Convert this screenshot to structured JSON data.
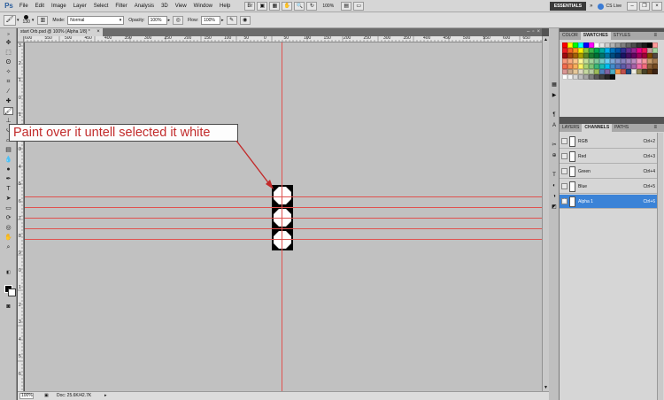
{
  "menubar": {
    "logo": "Ps",
    "items": [
      "File",
      "Edit",
      "Image",
      "Layer",
      "Select",
      "Filter",
      "Analysis",
      "3D",
      "View",
      "Window",
      "Help"
    ],
    "zoom": "100%",
    "workspace": "ESSENTIALS",
    "cs_live": "CS Live"
  },
  "options": {
    "brush_size": "130",
    "mode_label": "Mode:",
    "mode_value": "Normal",
    "opacity_label": "Opacity:",
    "opacity_value": "100%",
    "flow_label": "Flow:",
    "flow_value": "100%"
  },
  "document": {
    "tab_title": "start Orb.psd @ 100% (Alpha 1/8) *"
  },
  "ruler": {
    "h_labels": [
      "600",
      "550",
      "500",
      "450",
      "400",
      "350",
      "300",
      "250",
      "200",
      "150",
      "100",
      "50",
      "0",
      "50",
      "100",
      "150",
      "200",
      "250",
      "300",
      "350",
      "400",
      "450",
      "500",
      "550",
      "600",
      "650"
    ],
    "v_labels": [
      "3",
      "2",
      "1",
      "0",
      "1",
      "2",
      "3",
      "4",
      "5",
      "6",
      "7",
      "8",
      "9",
      "0",
      "1",
      "2",
      "3",
      "4",
      "5",
      "6"
    ]
  },
  "statusbar": {
    "zoom": "100%",
    "doc_info": "Doc: 25.6K/42.7K"
  },
  "annotation": {
    "text": "Paint over it untell selected it white"
  },
  "swatch_panel": {
    "tabs": [
      "COLOR",
      "SWATCHES",
      "STYLES"
    ],
    "active_tab": 1,
    "colors": [
      "#ff0000",
      "#ffff00",
      "#00ff00",
      "#00ffff",
      "#0000ff",
      "#ff00ff",
      "#ffffff",
      "#e6e6e6",
      "#cccccc",
      "#b3b3b3",
      "#999999",
      "#808080",
      "#666666",
      "#4d4d4d",
      "#333333",
      "#1a1a1a",
      "#000000",
      "#ff9999",
      "#ed1c24",
      "#f26522",
      "#f7941d",
      "#fff200",
      "#8dc63f",
      "#39b54a",
      "#00a651",
      "#00a99d",
      "#00aeef",
      "#0072bc",
      "#0054a6",
      "#2e3192",
      "#662d91",
      "#92278f",
      "#ec008c",
      "#ed145b",
      "#c4a0a0",
      "#a3d39c",
      "#9e0b0f",
      "#a0410d",
      "#a36209",
      "#aba000",
      "#598527",
      "#1a7b30",
      "#007236",
      "#00746b",
      "#0076a3",
      "#004b80",
      "#003471",
      "#1b1464",
      "#440e62",
      "#630460",
      "#9e005d",
      "#9e0039",
      "#7d4900",
      "#534741",
      "#f7977a",
      "#f9ad81",
      "#fdc68a",
      "#fff79a",
      "#c4df9b",
      "#a3d39c",
      "#82ca9d",
      "#7bcdc8",
      "#6ecff6",
      "#7ea7d8",
      "#8493ca",
      "#8882be",
      "#a187be",
      "#bc8cbf",
      "#f49ac2",
      "#f6989d",
      "#c69c6d",
      "#a67c52",
      "#f26c4f",
      "#f68e56",
      "#fbaf5d",
      "#fff467",
      "#acd373",
      "#7cc576",
      "#3bb878",
      "#1abbb4",
      "#00bff3",
      "#438ccb",
      "#5574b9",
      "#605ca8",
      "#855fa8",
      "#a763a8",
      "#f06eaa",
      "#f26d7d",
      "#8c6239",
      "#754c24",
      "#d99694",
      "#c9a98b",
      "#e6c89a",
      "#ddd9c3",
      "#c6d9a0",
      "#b8cca4",
      "#9bbb59",
      "#4f81bd",
      "#8064a2",
      "#4bacc6",
      "#f79646",
      "#c0504d",
      "#1f497d",
      "#eeece1",
      "#938953",
      "#494429",
      "#603913",
      "#3c2415",
      "#ffffff",
      "#f2f2f2",
      "#d9d9d9",
      "#bfbfbf",
      "#a6a6a6",
      "#7f7f7f",
      "#595959",
      "#404040",
      "#262626",
      "#0d0d0d"
    ]
  },
  "channels_panel": {
    "tabs": [
      "LAYERS",
      "CHANNELS",
      "PATHS"
    ],
    "active_tab": 1,
    "rows": [
      {
        "name": "RGB",
        "key": "Ctrl+2",
        "selected": false
      },
      {
        "name": "Red",
        "key": "Ctrl+3",
        "selected": false
      },
      {
        "name": "Green",
        "key": "Ctrl+4",
        "selected": false
      },
      {
        "name": "Blue",
        "key": "Ctrl+5",
        "selected": false
      },
      {
        "name": "Alpha 1",
        "key": "Ctrl+6",
        "selected": true
      }
    ]
  },
  "colors": {
    "guide": "#e0524f",
    "selection": "#3b83d7",
    "annotation_text": "#c22b2b"
  }
}
